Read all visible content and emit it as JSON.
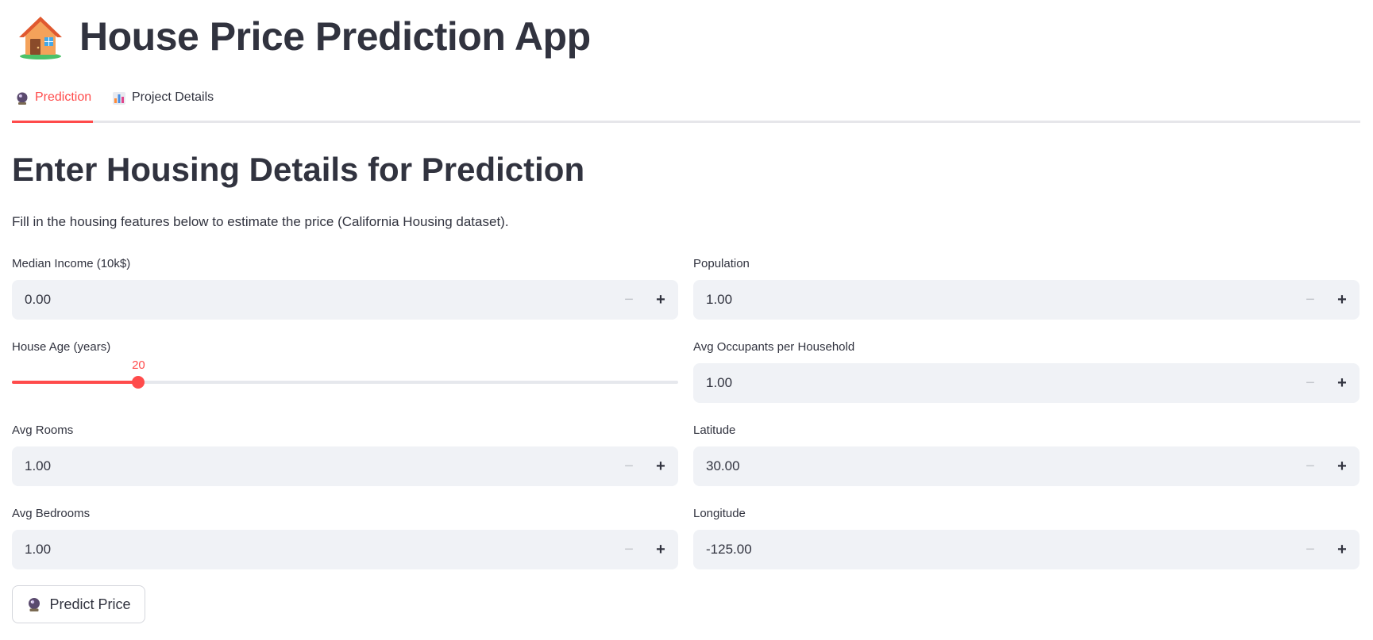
{
  "app": {
    "title": "House Price Prediction App",
    "title_icon": "house-icon"
  },
  "tabs": [
    {
      "label": "Prediction",
      "icon": "crystal-ball-icon",
      "active": true
    },
    {
      "label": "Project Details",
      "icon": "bar-chart-icon",
      "active": false
    }
  ],
  "main": {
    "heading": "Enter Housing Details for Prediction",
    "description": "Fill in the housing features below to estimate the price (California Housing dataset)."
  },
  "fields": {
    "median_income": {
      "label": "Median Income (10k$)",
      "value": "0.00"
    },
    "population": {
      "label": "Population",
      "value": "1.00"
    },
    "house_age": {
      "label": "House Age (years)",
      "value": "20",
      "min": 0,
      "max": 100,
      "fraction": 0.19
    },
    "avg_occupants": {
      "label": "Avg Occupants per Household",
      "value": "1.00"
    },
    "avg_rooms": {
      "label": "Avg Rooms",
      "value": "1.00"
    },
    "latitude": {
      "label": "Latitude",
      "value": "30.00"
    },
    "avg_bedrooms": {
      "label": "Avg Bedrooms",
      "value": "1.00"
    },
    "longitude": {
      "label": "Longitude",
      "value": "-125.00"
    }
  },
  "stepper": {
    "minus": "−",
    "plus": "+"
  },
  "predict_button": {
    "label": "Predict Price",
    "icon": "crystal-ball-icon"
  },
  "colors": {
    "accent": "#ff4b4b",
    "text": "#31333f",
    "input_bg": "#f0f2f6"
  }
}
